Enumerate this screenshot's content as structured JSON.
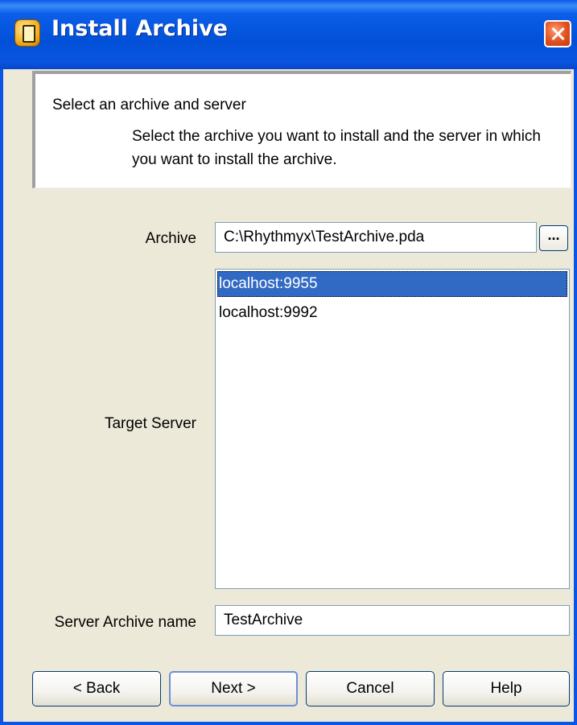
{
  "window": {
    "title": "Install Archive",
    "title_icon": "archive-icon",
    "close_icon": "close-icon"
  },
  "header": {
    "title": "Select an archive and server",
    "description": "Select the archive you want to install and the server in which you want to install the archive."
  },
  "archive": {
    "label": "Archive",
    "value": "C:\\Rhythmyx\\TestArchive.pda",
    "browse_label": "..."
  },
  "target_server": {
    "label": "Target Server",
    "items": [
      "localhost:9955",
      "localhost:9992"
    ],
    "selected": "localhost:9955"
  },
  "server_archive_name": {
    "label": "Server Archive name",
    "value": "TestArchive"
  },
  "buttons": {
    "back": "< Back",
    "next": "Next >",
    "cancel": "Cancel",
    "help": "Help"
  },
  "colors": {
    "titlebar": "#0250d8",
    "selection": "#316ac5",
    "dialog_bg": "#ece9d8"
  }
}
